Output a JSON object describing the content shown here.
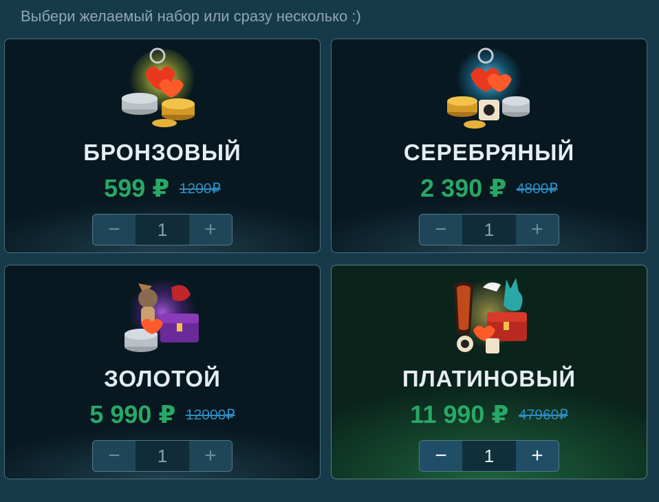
{
  "heading": "Выбери желаемый набор или сразу несколько :)",
  "colors": {
    "price": "#28a865",
    "old_price": "#2e8ec4",
    "highlight": "#1f6a42"
  },
  "packs": [
    {
      "title": "БРОНЗОВЫЙ",
      "price": "599 ₽",
      "old_price": "1200₽",
      "quantity": "1",
      "minus": "−",
      "plus": "+",
      "icon": "bronze-pack-icon"
    },
    {
      "title": "СЕРЕБРЯНЫЙ",
      "price": "2 390 ₽",
      "old_price": "4800₽",
      "quantity": "1",
      "minus": "−",
      "plus": "+",
      "icon": "silver-pack-icon"
    },
    {
      "title": "ЗОЛОТОЙ",
      "price": "5 990 ₽",
      "old_price": "12000₽",
      "quantity": "1",
      "minus": "−",
      "plus": "+",
      "icon": "gold-pack-icon"
    },
    {
      "title": "ПЛАТИНОВЫЙ",
      "price": "11 990 ₽",
      "old_price": "47960₽",
      "quantity": "1",
      "minus": "−",
      "plus": "+",
      "icon": "platinum-pack-icon"
    }
  ]
}
